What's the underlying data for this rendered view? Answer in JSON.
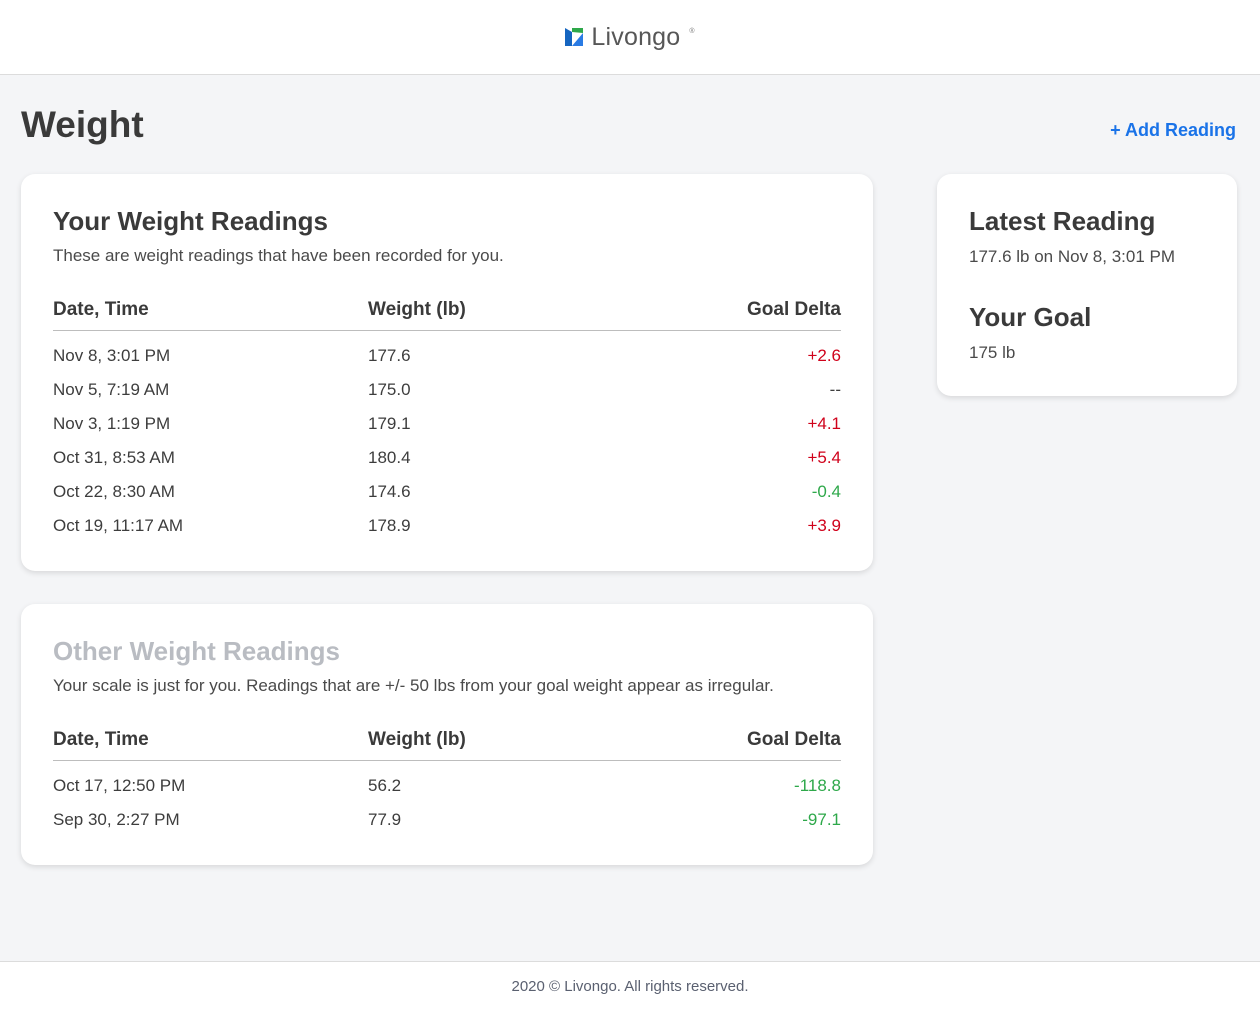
{
  "header": {
    "logo_text": "Livongo",
    "logo_reg": "®",
    "logo_icon": "livongo-mark-icon",
    "colors": {
      "brand_blue": "#1565c0",
      "brand_green": "#2ea84a"
    }
  },
  "page": {
    "title": "Weight",
    "add_reading_label": "+ Add Reading"
  },
  "your_readings": {
    "title": "Your Weight Readings",
    "subtitle": "These are weight readings that have been recorded for you.",
    "columns": [
      "Date, Time",
      "Weight (lb)",
      "Goal Delta"
    ],
    "rows": [
      {
        "date": "Nov 8, 3:01 PM",
        "weight": "177.6",
        "delta": "+2.6",
        "trend": "pos"
      },
      {
        "date": "Nov 5, 7:19 AM",
        "weight": "175.0",
        "delta": "--",
        "trend": "none"
      },
      {
        "date": "Nov 3, 1:19 PM",
        "weight": "179.1",
        "delta": "+4.1",
        "trend": "pos"
      },
      {
        "date": "Oct 31, 8:53 AM",
        "weight": "180.4",
        "delta": "+5.4",
        "trend": "pos"
      },
      {
        "date": "Oct 22, 8:30 AM",
        "weight": "174.6",
        "delta": "-0.4",
        "trend": "neg"
      },
      {
        "date": "Oct 19, 11:17 AM",
        "weight": "178.9",
        "delta": "+3.9",
        "trend": "pos"
      }
    ]
  },
  "other_readings": {
    "title": "Other Weight Readings",
    "subtitle": "Your scale is just for you. Readings that are +/- 50 lbs from your goal weight appear as irregular.",
    "columns": [
      "Date, Time",
      "Weight (lb)",
      "Goal Delta"
    ],
    "rows": [
      {
        "date": "Oct 17, 12:50 PM",
        "weight": "56.2",
        "delta": "-118.8",
        "trend": "neg"
      },
      {
        "date": "Sep 30, 2:27 PM",
        "weight": "77.9",
        "delta": "-97.1",
        "trend": "neg"
      }
    ]
  },
  "side": {
    "latest_title": "Latest Reading",
    "latest_value": "177.6 lb on Nov 8, 3:01 PM",
    "goal_title": "Your Goal",
    "goal_value": "175 lb"
  },
  "footer": {
    "text": "2020 © Livongo. All rights reserved."
  }
}
